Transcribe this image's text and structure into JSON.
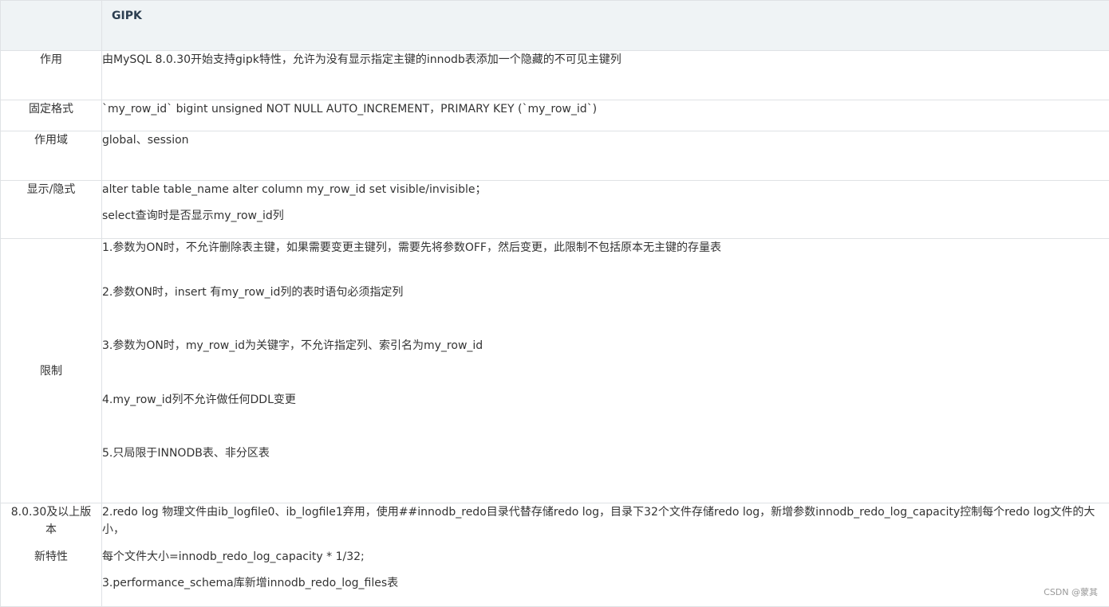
{
  "header": {
    "title": "GIPK"
  },
  "rows": [
    {
      "label": "作用",
      "lines": [
        "由MySQL 8.0.30开始支持gipk特性，允许为没有显示指定主键的innodb表添加一个隐藏的不可见主键列"
      ]
    },
    {
      "label": "固定格式",
      "lines": [
        "`my_row_id` bigint unsigned NOT NULL AUTO_INCREMENT，PRIMARY KEY (`my_row_id`)"
      ]
    },
    {
      "label": "作用域",
      "lines": [
        "global、session"
      ]
    },
    {
      "label": "显示/隐式",
      "lines": [
        "alter table  table_name alter column my_row_id set visible/invisible；",
        "select查询时是否显示my_row_id列"
      ]
    },
    {
      "label": "限制",
      "lines": [
        "1.参数为ON时，不允许删除表主键，如果需要变更主键列，需要先将参数OFF，然后变更，此限制不包括原本无主键的存量表",
        "2.参数ON时，insert 有my_row_id列的表时语句必须指定列",
        "3.参数为ON时，my_row_id为关键字，不允许指定列、索引名为my_row_id",
        "4.my_row_id列不允许做任何DDL变更",
        "5.只局限于INNODB表、非分区表"
      ]
    },
    {
      "label_line1": "8.0.30及以上版",
      "label_line2": "本",
      "label_line3": "新特性",
      "lines": [
        "2.redo log 物理文件由ib_logfile0、ib_logfile1弃用，使用##innodb_redo目录代替存储redo log，目录下32个文件存储redo log，新增参数innodb_redo_log_capacity控制每个redo log文件的大小，",
        "每个文件大小=innodb_redo_log_capacity  * 1/32;",
        "3.performance_schema库新增innodb_redo_log_files表"
      ]
    }
  ],
  "watermark": "CSDN @蒙其"
}
